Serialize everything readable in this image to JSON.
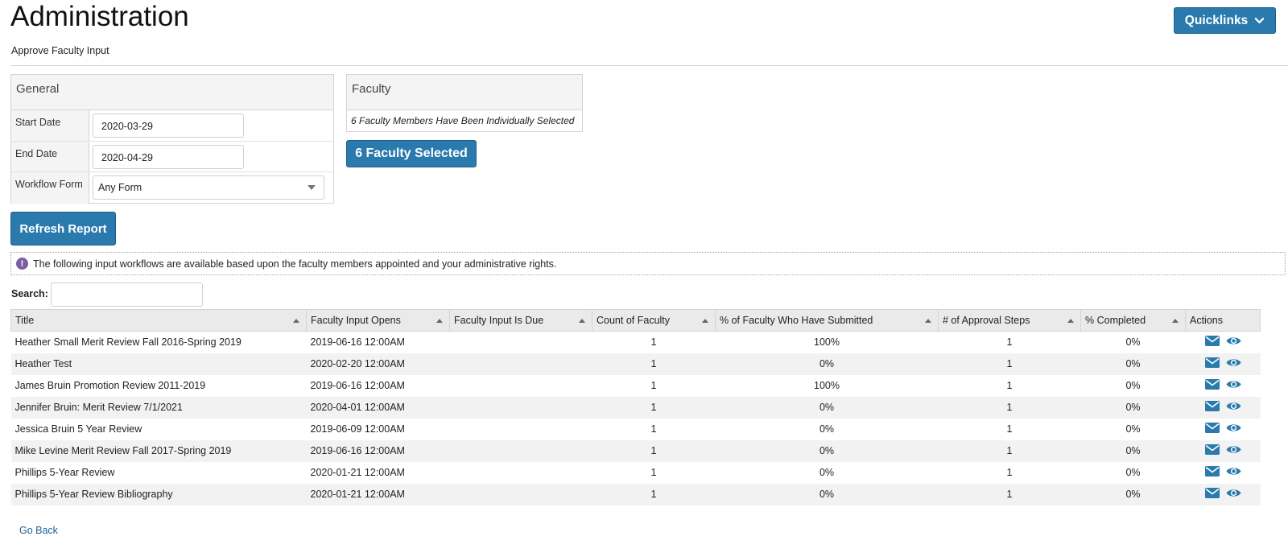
{
  "header": {
    "title": "Administration",
    "subtitle": "Approve Faculty Input",
    "quicklinks_label": "Quicklinks"
  },
  "general": {
    "heading": "General",
    "start_date_label": "Start Date",
    "start_date_value": "2020-03-29",
    "end_date_label": "End Date",
    "end_date_value": "2020-04-29",
    "workflow_form_label": "Workflow Form",
    "workflow_form_value": "Any Form"
  },
  "faculty": {
    "heading": "Faculty",
    "note": "6 Faculty Members Have Been Individually Selected",
    "button_label": "6 Faculty Selected"
  },
  "refresh_label": "Refresh Report",
  "info": {
    "icon": "exclamation-icon",
    "text": "The following input workflows are available based upon the faculty members appointed and your administrative rights."
  },
  "search": {
    "label": "Search:",
    "value": ""
  },
  "table": {
    "columns": [
      "Title",
      "Faculty Input Opens",
      "Faculty Input Is Due",
      "Count of Faculty",
      "% of Faculty Who Have Submitted",
      "# of Approval Steps",
      "% Completed",
      "Actions"
    ],
    "rows": [
      {
        "title": "Heather Small Merit Review Fall 2016-Spring 2019",
        "opens": "2019-06-16 12:00AM",
        "due": "",
        "count": "1",
        "submitted": "100%",
        "steps": "1",
        "completed": "0%"
      },
      {
        "title": "Heather Test",
        "opens": "2020-02-20 12:00AM",
        "due": "",
        "count": "1",
        "submitted": "0%",
        "steps": "1",
        "completed": "0%"
      },
      {
        "title": "James Bruin Promotion Review 2011-2019",
        "opens": "2019-06-16 12:00AM",
        "due": "",
        "count": "1",
        "submitted": "100%",
        "steps": "1",
        "completed": "0%"
      },
      {
        "title": "Jennifer Bruin: Merit Review 7/1/2021",
        "opens": "2020-04-01 12:00AM",
        "due": "",
        "count": "1",
        "submitted": "0%",
        "steps": "1",
        "completed": "0%"
      },
      {
        "title": "Jessica Bruin 5 Year Review",
        "opens": "2019-06-09 12:00AM",
        "due": "",
        "count": "1",
        "submitted": "0%",
        "steps": "1",
        "completed": "0%"
      },
      {
        "title": "Mike Levine Merit Review Fall 2017-Spring 2019",
        "opens": "2019-06-16 12:00AM",
        "due": "",
        "count": "1",
        "submitted": "0%",
        "steps": "1",
        "completed": "0%"
      },
      {
        "title": "Phillips 5-Year Review",
        "opens": "2020-01-21 12:00AM",
        "due": "",
        "count": "1",
        "submitted": "0%",
        "steps": "1",
        "completed": "0%"
      },
      {
        "title": "Phillips 5-Year Review Bibliography",
        "opens": "2020-01-21 12:00AM",
        "due": "",
        "count": "1",
        "submitted": "0%",
        "steps": "1",
        "completed": "0%"
      }
    ]
  },
  "footer": {
    "go_back_label": "Go Back"
  },
  "colors": {
    "primary_button": "#2a7aae",
    "link": "#1f5f9a",
    "info_icon": "#7b5ea7"
  }
}
